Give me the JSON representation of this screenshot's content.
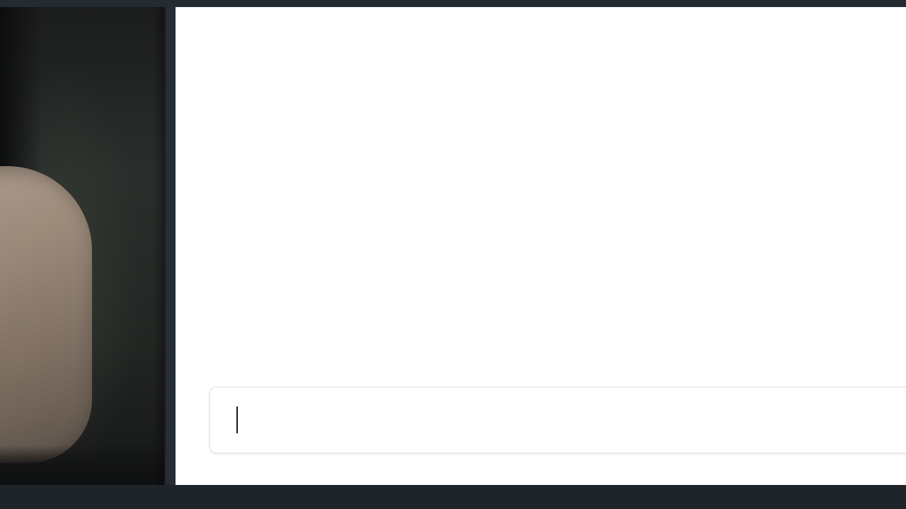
{
  "composer": {
    "value": "",
    "placeholder": ""
  },
  "colors": {
    "chat_background": "#ffffff",
    "frame_background": "#20252b",
    "composer_border": "#e6e6e6",
    "caret": "#1a1a1a"
  }
}
